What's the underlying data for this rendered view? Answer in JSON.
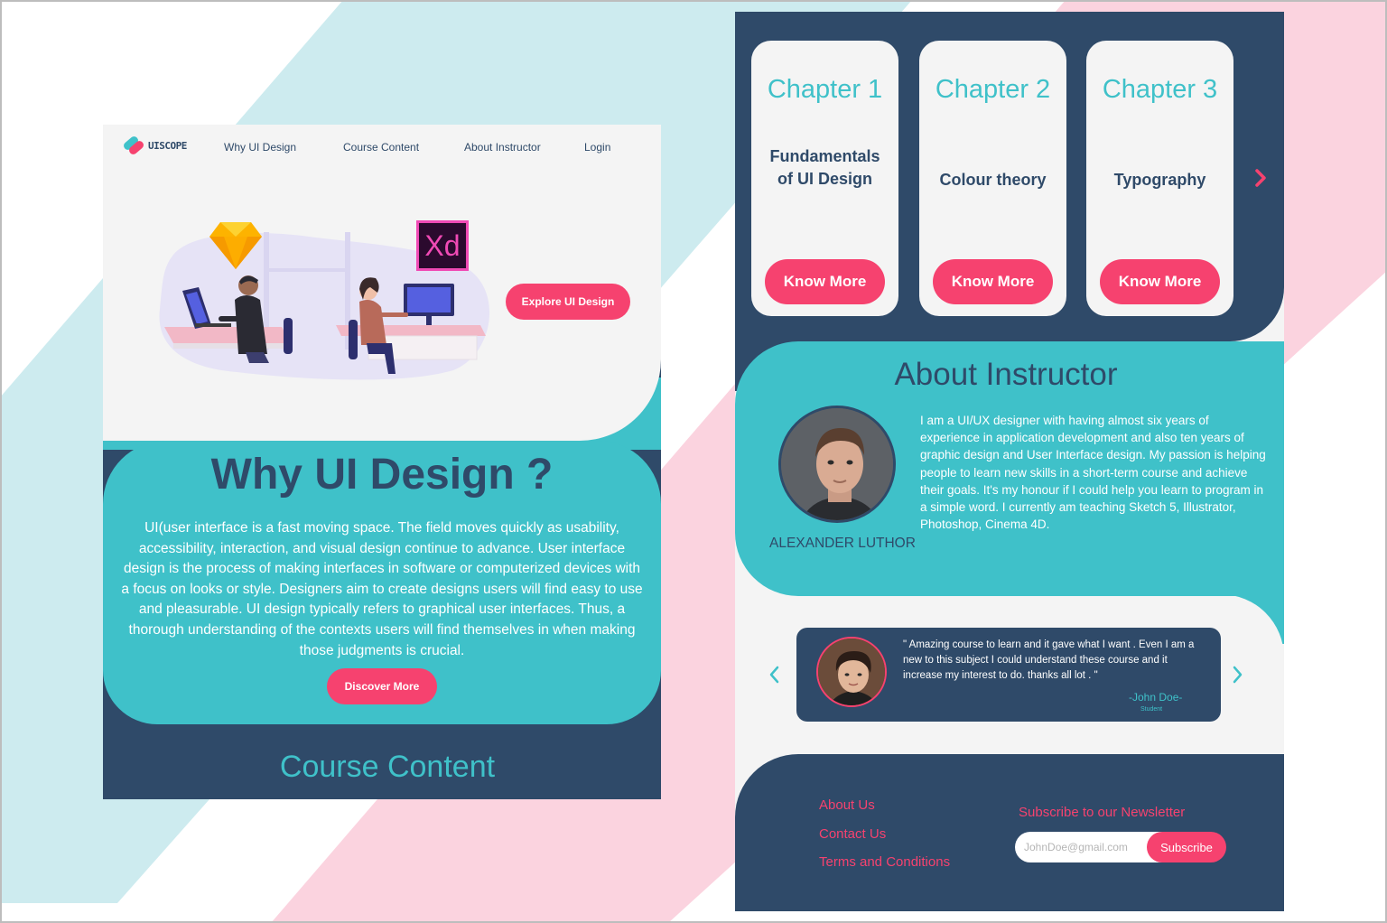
{
  "colors": {
    "navy": "#2f4a69",
    "teal": "#3fc1c9",
    "pink": "#f6426f",
    "light": "#f4f4f4",
    "bg_teal_stripe": "#cdebef",
    "bg_pink_stripe": "#fbd3df"
  },
  "landing": {
    "logo_text": "UISCOPE",
    "nav": {
      "why": "Why UI Design",
      "course": "Course Content",
      "about": "About Instructor",
      "login": "Login"
    },
    "hero": {
      "xd_label": "Xd",
      "explore_button": "Explore UI Design"
    },
    "why": {
      "title": "Why UI Design ?",
      "body": "UI(user interface is a fast moving space. The field moves quickly as usability, accessibility, interaction, and visual design continue to advance.  User interface design is the process of making interfaces in software or computerized devices with a focus on looks or style. Designers aim  to create designs users will find easy to use and pleasurable. UI design typically refers to graphical user interfaces. Thus, a thorough understanding of the contexts users will find themselves in when making those judgments is crucial.",
      "discover_button": "Discover More"
    },
    "course_title": "Course Content"
  },
  "chapters": [
    {
      "title": "Chapter 1",
      "topic": "Fundamentals of UI Design",
      "button": "Know More"
    },
    {
      "title": "Chapter 2",
      "topic": "Colour theory",
      "button": "Know More"
    },
    {
      "title": "Chapter 3",
      "topic": "Typography",
      "button": "Know More"
    }
  ],
  "about": {
    "title": "About Instructor",
    "name": "ALEXANDER LUTHOR",
    "bio": "I am a UI/UX designer with having almost six years of experience in application development and also ten years of graphic design and User Interface design. My passion is helping people to learn new skills in a short-term course and achieve their goals. It's my honour  if I could help you learn to program in a simple word. I currently am teaching Sketch 5, Illustrator, Photoshop, Cinema 4D."
  },
  "testimonial": {
    "quote": "\" Amazing course to learn and it gave what I want . Even I am a new to this subject I could understand these course and it increase my interest to do. thanks all lot . \"",
    "author": "-John Doe-",
    "role": "Student"
  },
  "footer": {
    "links": [
      "About Us",
      "Contact Us",
      "Terms and Conditions"
    ],
    "newsletter_title": "Subscribe to our Newsletter",
    "email_placeholder": "JohnDoe@gmail.com",
    "subscribe_button": "Subscribe"
  }
}
